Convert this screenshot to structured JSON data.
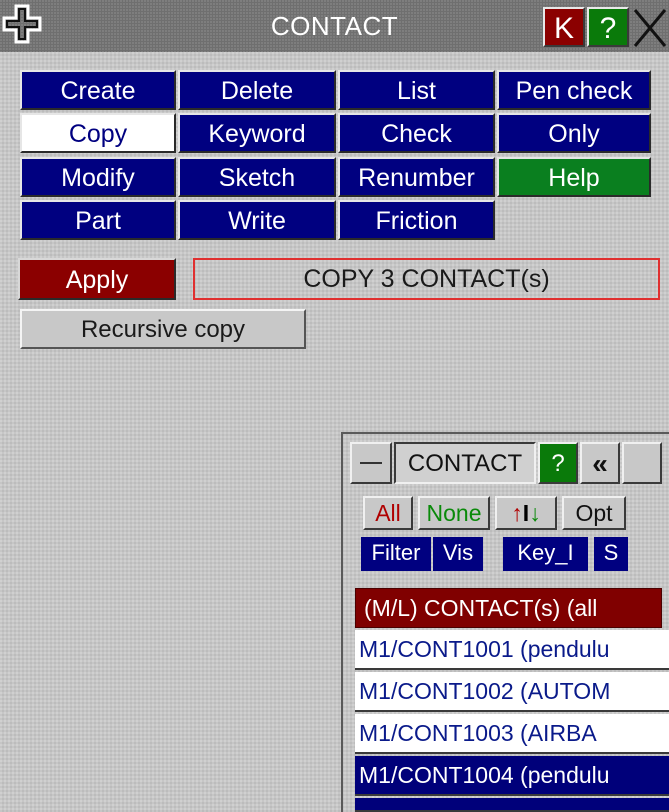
{
  "window": {
    "title": "CONTACT",
    "title_buttons": {
      "keyword": "K",
      "help": "?",
      "close": "X"
    },
    "colors": {
      "keyword_bg": "#8b0000",
      "help_bg": "#0a7a0a"
    }
  },
  "commands": [
    {
      "label": "Create",
      "state": "normal"
    },
    {
      "label": "Delete",
      "state": "normal"
    },
    {
      "label": "List",
      "state": "normal"
    },
    {
      "label": "Pen check",
      "state": "normal"
    },
    {
      "label": "Copy",
      "state": "active"
    },
    {
      "label": "Keyword",
      "state": "normal"
    },
    {
      "label": "Check",
      "state": "normal"
    },
    {
      "label": "Only",
      "state": "normal"
    },
    {
      "label": "Modify",
      "state": "normal"
    },
    {
      "label": "Sketch",
      "state": "normal"
    },
    {
      "label": "Renumber",
      "state": "normal"
    },
    {
      "label": "Help",
      "state": "help"
    },
    {
      "label": "Part",
      "state": "normal"
    },
    {
      "label": "Write",
      "state": "normal"
    },
    {
      "label": "Friction",
      "state": "normal"
    }
  ],
  "action": {
    "apply_label": "Apply",
    "status_text": "COPY 3 CONTACT(s)",
    "recursive_copy_label": "Recursive copy"
  },
  "selector": {
    "minimize_icon": "minus-icon",
    "title": "CONTACT",
    "help_label": "?",
    "collapse_label": "«",
    "filters": {
      "all": "All",
      "none": "None",
      "sort_up": "↑",
      "sort_sep": "I",
      "sort_down": "↓",
      "opt": "Opt"
    },
    "modes": {
      "filter": "Filter",
      "vis": "Vis",
      "key": "Key_I",
      "s": "S"
    },
    "list_header": "(M/L) CONTACT(s) (all",
    "items": [
      {
        "label": "M1/CONT1001 (pendulu",
        "selected": false
      },
      {
        "label": "M1/CONT1002 (AUTOM",
        "selected": false
      },
      {
        "label": "M1/CONT1003 (AIRBA",
        "selected": false
      },
      {
        "label": "M1/CONT1004 (pendulu",
        "selected": true
      }
    ]
  }
}
